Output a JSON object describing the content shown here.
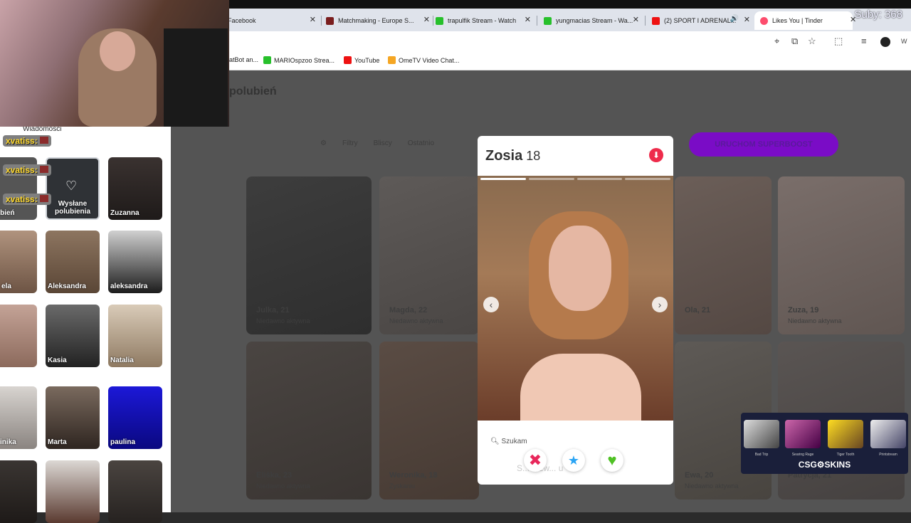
{
  "overlay": {
    "subs": "Suby: 368"
  },
  "browser": {
    "tabs": [
      {
        "label": "Facebook"
      },
      {
        "label": "Matchmaking - Europe S..."
      },
      {
        "label": "trapulfik Stream - Watch"
      },
      {
        "label": "yungmacias Stream - Wa..."
      },
      {
        "label": "(2) SPORT I ADRENAL..."
      },
      {
        "label": "Likes You | Tinder"
      }
    ],
    "bookmarks": [
      {
        "label": "atBot an..."
      },
      {
        "label": "MARIOspzoo Strea..."
      },
      {
        "label": "YouTube"
      },
      {
        "label": "OmeTV Video Chat..."
      }
    ]
  },
  "page": {
    "title": "polubień",
    "filters": [
      "Filtry",
      "Bliscy",
      "Ostatnio"
    ],
    "boost_label": "URUCHOM SUPERBOOST",
    "grid_cards": [
      {
        "name": "Julka, 21",
        "status": "Niedawno aktywna"
      },
      {
        "name": "Magda, 22",
        "status": "Niedawno aktywna"
      },
      {
        "name": "Ola, 21",
        "status": ""
      },
      {
        "name": "Zuza, 19",
        "status": "Niedawno aktywna"
      },
      {
        "name": "Eliška, 23",
        "status": "Niedawno aktywna"
      },
      {
        "name": "Weronika, 18",
        "status": "Zyskaniu"
      },
      {
        "name": "Ewa, 20",
        "status": "Niedawno aktywna"
      },
      {
        "name": "Patrycja, 21",
        "status": ""
      }
    ]
  },
  "sidebar": {
    "tabs_label": "Wiadomości",
    "chat": [
      {
        "user": "xvatiss:"
      },
      {
        "user": "xvatiss:"
      },
      {
        "user": "xvatiss:"
      }
    ],
    "sent_likes_label": "Wysłane polubienia",
    "thumbs": [
      {
        "name": "polubień"
      },
      {
        "name": "Zuzanna"
      },
      {
        "name": "ela"
      },
      {
        "name": "Aleksandra"
      },
      {
        "name": "aleksandra"
      },
      {
        "name": ""
      },
      {
        "name": "Kasia"
      },
      {
        "name": "Natalia"
      },
      {
        "name": "inika"
      },
      {
        "name": "Marta"
      },
      {
        "name": "paulina"
      }
    ]
  },
  "profile": {
    "name": "Zosia",
    "age": "18",
    "search_label": "Szukam",
    "photo_count": 4,
    "active_photo": 1,
    "bottom_text": "S... o zw... u"
  },
  "ad": {
    "brand": "CSG⚙SKINS",
    "skins": [
      "Bad Trip",
      "Searing Rage",
      "Tiger Tooth",
      "Printstream"
    ]
  }
}
